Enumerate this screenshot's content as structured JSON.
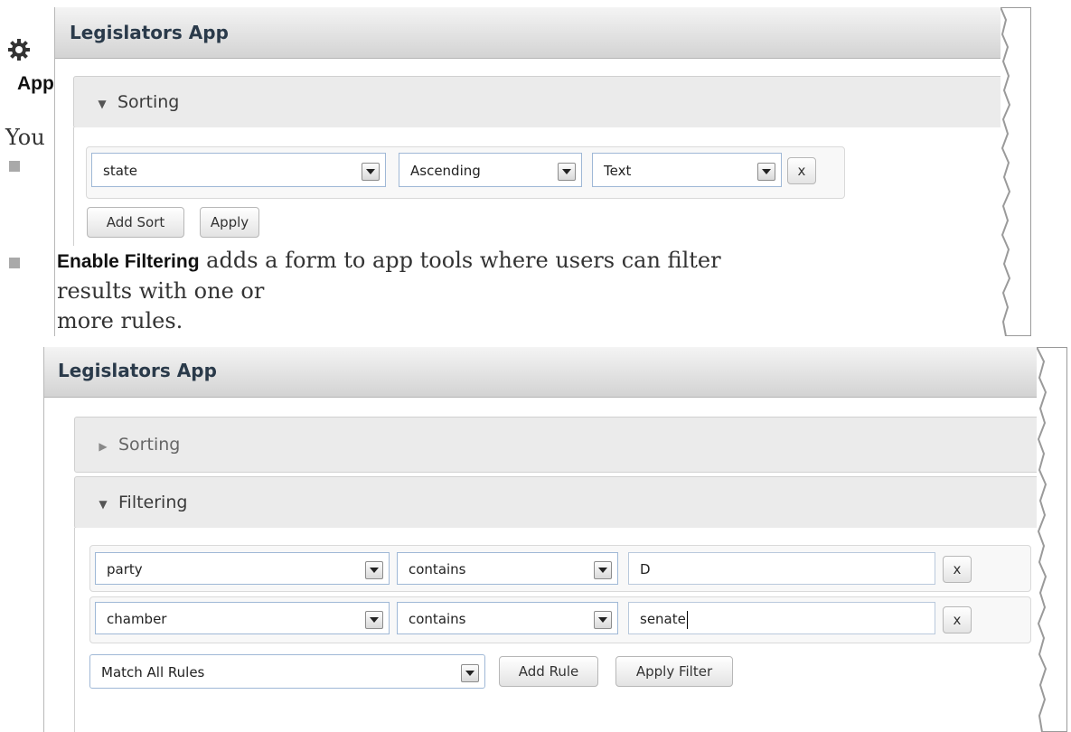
{
  "doc": {
    "heading": "App",
    "intro": "You",
    "filtering_term": "Enable Filtering",
    "filtering_desc_line1": " adds a form to app tools where users can filter results with one or",
    "filtering_desc_line2": "more rules."
  },
  "screenshot1": {
    "title": "Legislators App",
    "sorting_header": "Sorting",
    "sort_rule": {
      "field": "state",
      "direction": "Ascending",
      "type": "Text",
      "remove_label": "x"
    },
    "add_sort_label": "Add Sort",
    "apply_label": "Apply"
  },
  "screenshot2": {
    "title": "Legislators App",
    "sorting_header": "Sorting",
    "filtering_header": "Filtering",
    "rules": [
      {
        "field": "party",
        "operator": "contains",
        "value": "D",
        "remove_label": "x"
      },
      {
        "field": "chamber",
        "operator": "contains",
        "value": "senate",
        "remove_label": "x"
      }
    ],
    "match_mode": "Match All Rules",
    "add_rule_label": "Add Rule",
    "apply_filter_label": "Apply Filter"
  },
  "colors": {
    "field_border": "#9fb8d6",
    "titlebar_text": "#2a3a4a",
    "bullet": "#a9a9a9"
  }
}
